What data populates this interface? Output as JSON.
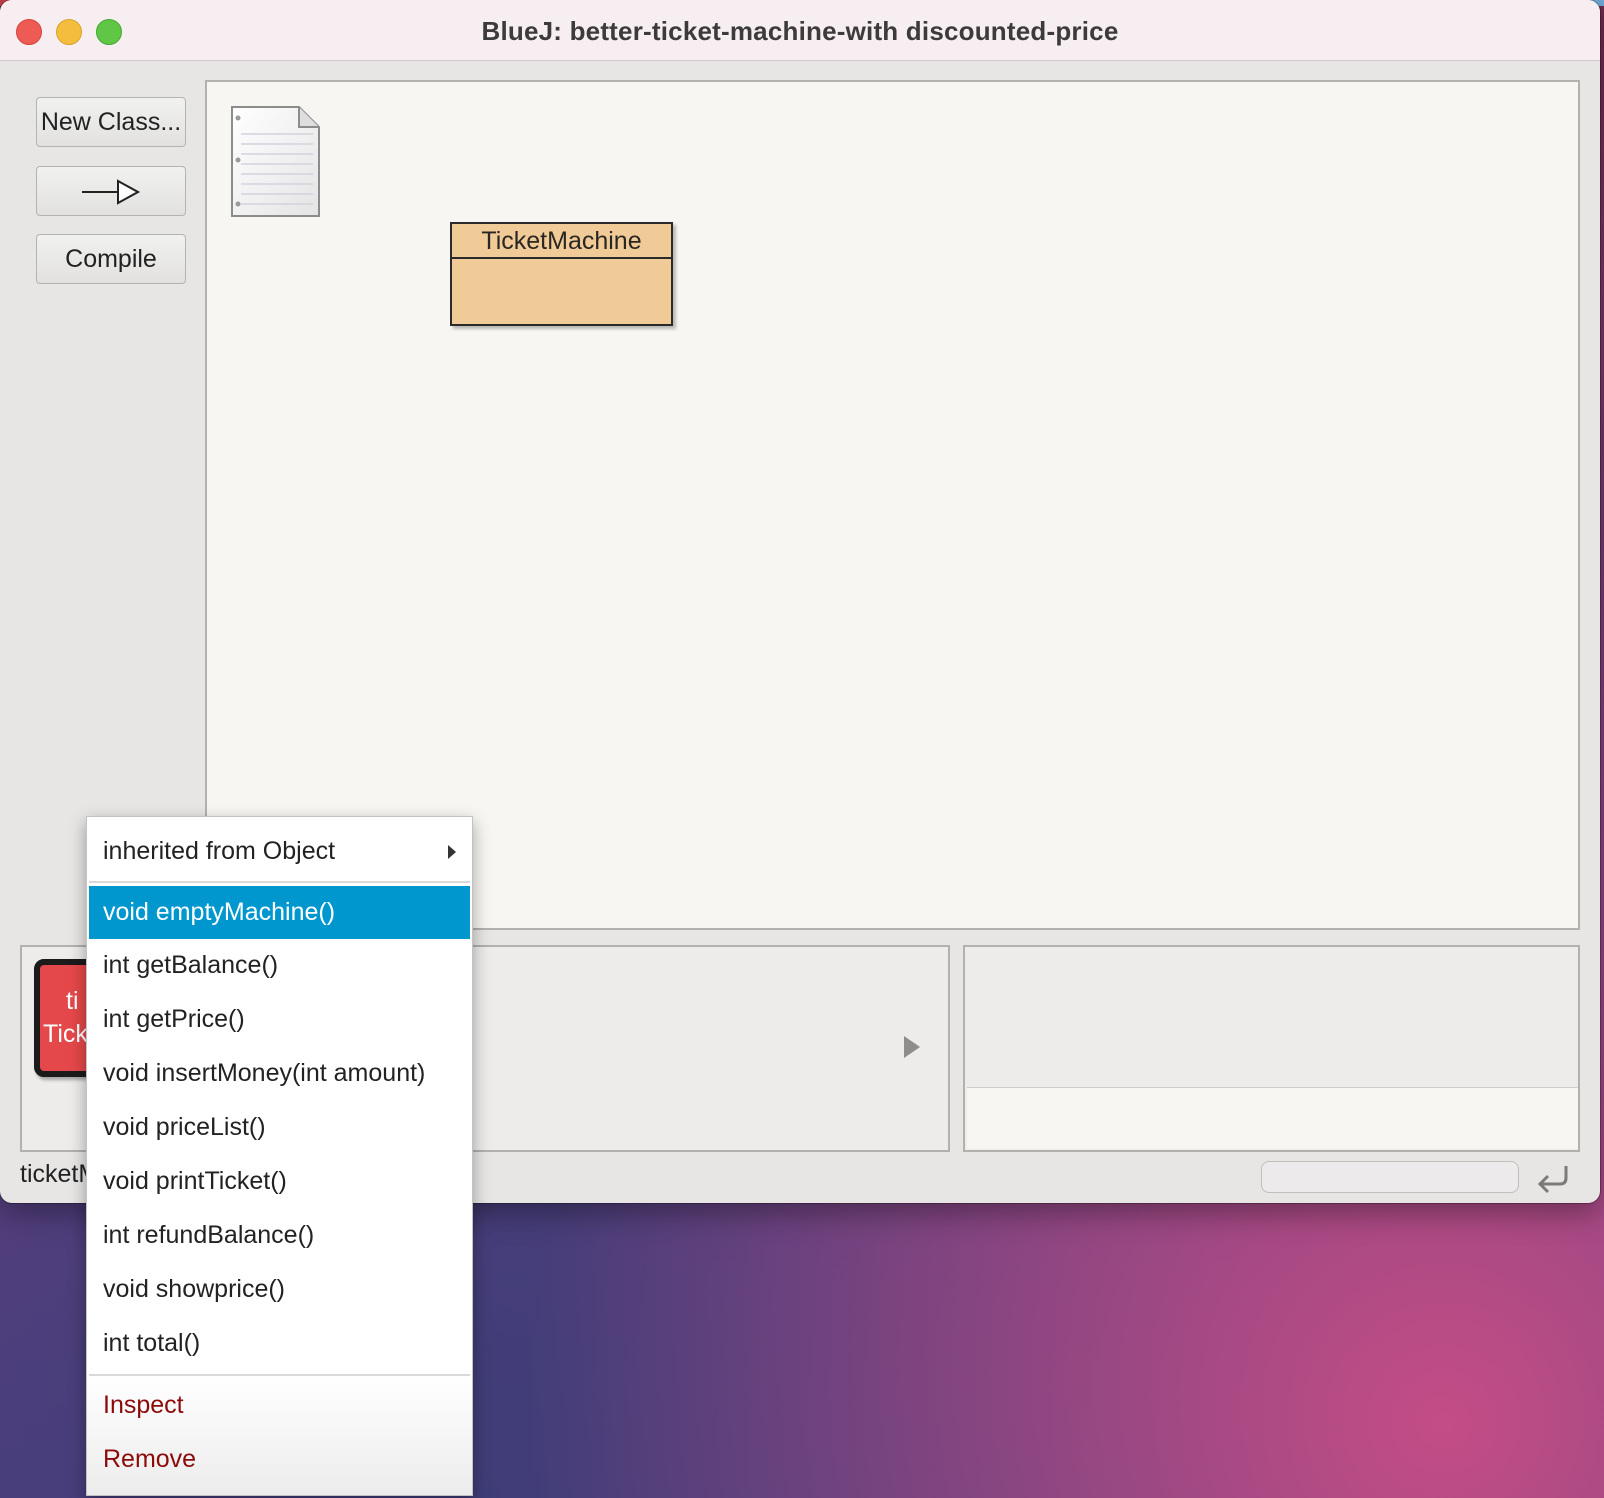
{
  "window": {
    "title": "BlueJ:  better-ticket-machine-with discounted-price"
  },
  "toolbar": {
    "new_class_label": "New Class...",
    "compile_label": "Compile"
  },
  "diagram": {
    "class_name": "TicketMachine",
    "class_color": "#f0cb98"
  },
  "object_bench": {
    "object_line1": "ti",
    "object_line2": "Tick",
    "object_color": "#e5484a"
  },
  "status": {
    "text": "ticketM"
  },
  "context_menu": {
    "inherited_label": "inherited from Object",
    "methods": [
      "void emptyMachine()",
      "int getBalance()",
      "int getPrice()",
      "void insertMoney(int amount)",
      "void priceList()",
      "void printTicket()",
      "int refundBalance()",
      "void showprice()",
      "int total()"
    ],
    "selected_index": 0,
    "selection_color": "#0097cf",
    "inspect_label": "Inspect",
    "remove_label": "Remove"
  }
}
